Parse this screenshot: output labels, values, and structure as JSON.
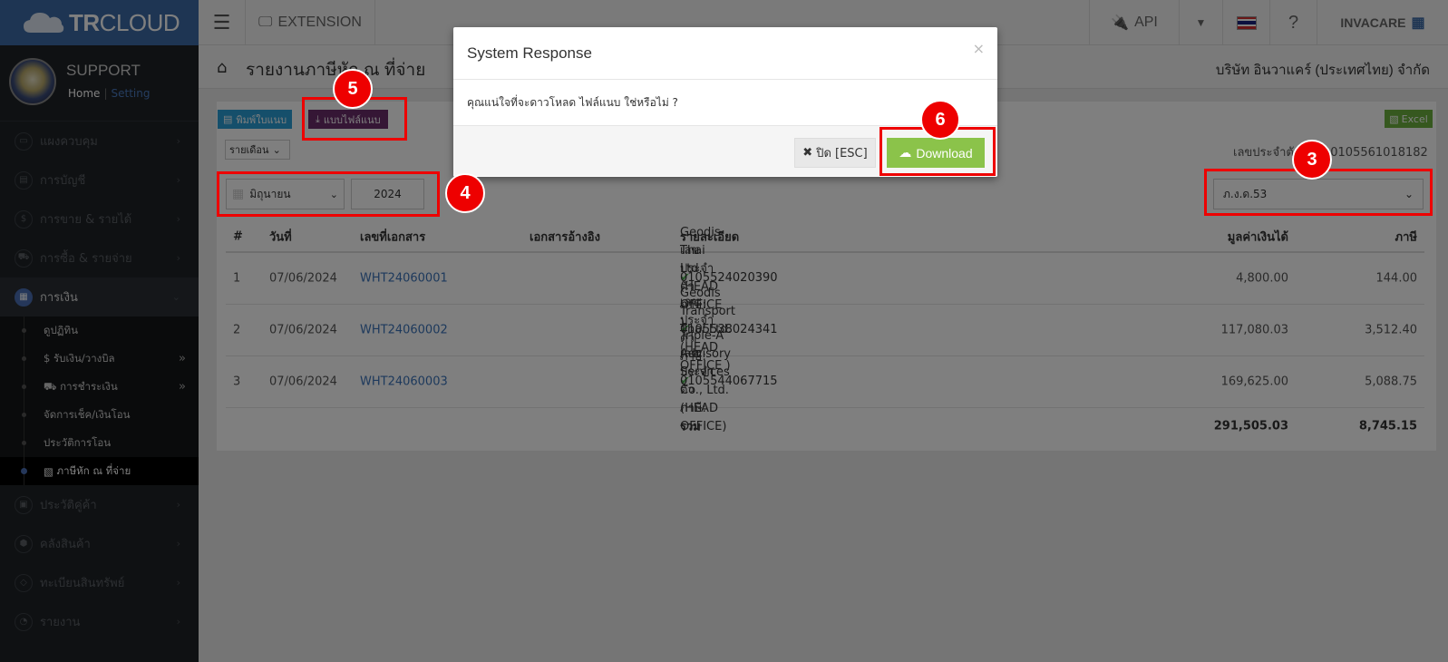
{
  "app": {
    "logo_bold": "TR",
    "logo_light": "CLOUD"
  },
  "topbar": {
    "extension_label": "EXTENSION",
    "api_label": "API",
    "company_short": "INVACARE",
    "colors": {
      "brand": "#3c6aa6"
    }
  },
  "profile": {
    "name": "SUPPORT",
    "home_link": "Home",
    "setting_link": "Setting"
  },
  "sidebar": {
    "items": [
      {
        "label": "แผงควบคุม",
        "icon": "monitor-icon"
      },
      {
        "label": "การบัญชี",
        "icon": "book-icon"
      },
      {
        "label": "การขาย & รายได้",
        "icon": "dollar-icon"
      },
      {
        "label": "การซื้อ & รายจ่าย",
        "icon": "cart-icon"
      },
      {
        "label": "การเงิน",
        "icon": "calendar-icon"
      }
    ],
    "sub_items": [
      {
        "label": "ดูปฏิทิน"
      },
      {
        "label": "$ รับเงิน/วางบิล"
      },
      {
        "label": "การชำระเงิน"
      },
      {
        "label": "จัดการเช็ค/เงินโอน"
      },
      {
        "label": "ประวัติการโอน"
      },
      {
        "label": "ภาษีหัก ณ ที่จ่าย"
      }
    ],
    "items_after": [
      {
        "label": "ประวัติคู่ค้า",
        "icon": "contacts-icon"
      },
      {
        "label": "คลังสินค้า",
        "icon": "cubes-icon"
      },
      {
        "label": "ทะเบียนสินทรัพย์",
        "icon": "diamond-icon"
      },
      {
        "label": "รายงาน",
        "icon": "report-icon"
      }
    ]
  },
  "page": {
    "title": "รายงานภาษีหัก ณ ที่จ่าย",
    "company_name": "บริษัท อินวาแคร์ (ประเทศไทย) จำกัด"
  },
  "toolbar": {
    "print_label": "พิมพ์ใบแนบ",
    "attach_label": "แบบไฟล์แนบ",
    "excel_label": "Excel"
  },
  "filters": {
    "period_value": "รายเดือน",
    "taxid_label": "เลขประจำตัว",
    "taxid_value": "0105561018182",
    "month_value": "มิถุนายน",
    "year_value": "2024",
    "form_value": "ภ.ง.ด.53"
  },
  "table": {
    "headers": {
      "no": "#",
      "date": "วันที่",
      "doc": "เลขที่เอกสาร",
      "ref": "เอกสารอ้างอิง",
      "detail": "รายละเอียด",
      "amount": "มูลค่าเงินได้",
      "tax": "ภาษี"
    },
    "taxid_prefix": "เลขประจำตัวภาษี: ",
    "rows": [
      {
        "no": "1",
        "date": "07/06/2024",
        "doc": "WHT24060001",
        "company": "Geodis Thai Ltd. (HEAD OFFICE )",
        "taxid": "0105524020390",
        "amount": "4,800.00",
        "tax": "144.00"
      },
      {
        "no": "2",
        "date": "07/06/2024",
        "doc": "WHT24060002",
        "company": "Geodis Transport Thai Ltd. (HEAD OFFICE )",
        "taxid": "0105538024341",
        "amount": "117,080.03",
        "tax": "3,512.40"
      },
      {
        "no": "3",
        "date": "07/06/2024",
        "doc": "WHT24060003",
        "company": "Triple-A Advisory Services Co., Ltd. (HEAD OFFICE)",
        "taxid": "0105544067715",
        "amount": "169,625.00",
        "tax": "5,088.75"
      }
    ],
    "total_label": "รวม",
    "total_amount": "291,505.03",
    "total_tax": "8,745.15"
  },
  "modal": {
    "title": "System Response",
    "close_x": "×",
    "message": "คุณแน่ใจที่จะดาวโหลด ไฟล์แนบ ใช่หรือไม่ ?",
    "close_label": "ปิด [ESC]",
    "download_label": "Download"
  },
  "callouts": [
    "5",
    "6",
    "3",
    "4"
  ]
}
